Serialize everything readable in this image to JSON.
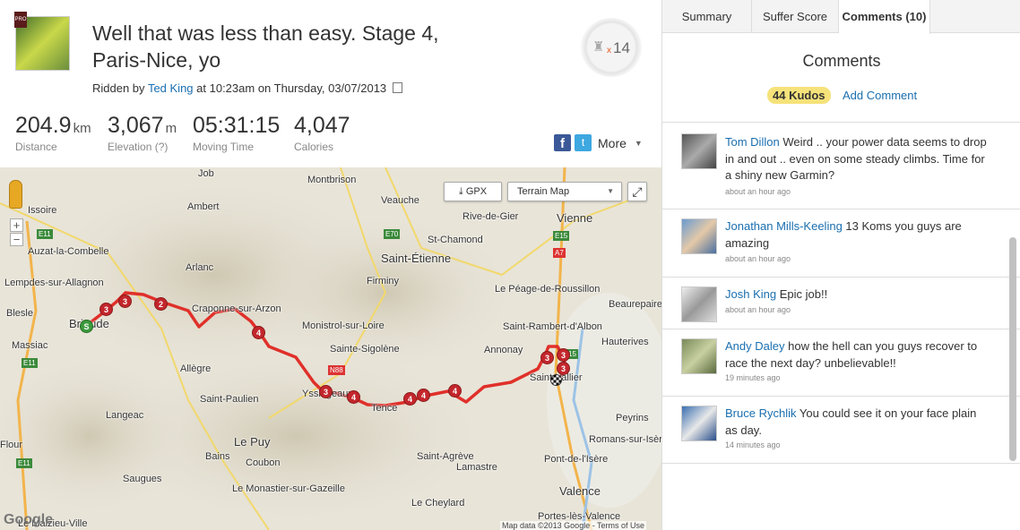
{
  "activity": {
    "title": "Well that was less than easy. Stage 4, Paris-Nice, yo",
    "ridden_prefix": "Ridden by",
    "rider": "Ted King",
    "ridden_suffix": "at 10:23am on Thursday, 03/07/2013",
    "achievements": "14",
    "achievements_x": "x"
  },
  "stats": [
    {
      "value": "204.9",
      "unit": "km",
      "label": "Distance"
    },
    {
      "value": "3,067",
      "unit": "m",
      "label": "Elevation (?)"
    },
    {
      "value": "05:31:15",
      "unit": "",
      "label": "Moving Time"
    },
    {
      "value": "4,047",
      "unit": "",
      "label": "Calories"
    }
  ],
  "share": {
    "more": "More"
  },
  "map": {
    "gpx": "GPX",
    "map_type": "Terrain Map",
    "google": "Google",
    "map_data": "Map data ©2013 Google - Terms of Use",
    "places": [
      "Issoire",
      "Job",
      "Montbrison",
      "Veauche",
      "Ambert",
      "Rive-de-Gier",
      "Vienne",
      "St-Chamond",
      "Auzat-la-Combelle",
      "Saint-Étienne",
      "Arlanc",
      "Firminy",
      "Lempdes-sur-Allagnon",
      "Le Péage-de-Roussillon",
      "Craponne-sur-Arzon",
      "Blesle",
      "Brioude",
      "Monistrol-sur-Loire",
      "Saint-Rambert-d'Albon",
      "Beaurepaire",
      "Massiac",
      "Sainte-Sigolène",
      "Annonay",
      "Hauterives",
      "Allègre",
      "Yssingeaux",
      "Saint-Vallier",
      "Saint-Paulien",
      "Tence",
      "Peyrins",
      "Langeac",
      "Le Puy",
      "Romans-sur-Isère",
      "Flour",
      "Bains",
      "Coubon",
      "Saint-Agrève",
      "Pont-de-l'Isère",
      "Lamastre",
      "Saugues",
      "Valence",
      "Le Monastier-sur-Gazeille",
      "Le Cheylard",
      "Le Malzieu-Ville",
      "Portes-lès-Valence"
    ],
    "roads": [
      "E11",
      "E70",
      "A7",
      "E15",
      "E11",
      "N88",
      "15",
      "E11"
    ],
    "markers": [
      "3",
      "3",
      "2",
      "4",
      "3",
      "4",
      "4",
      "4",
      "4",
      "3",
      "3",
      "3"
    ],
    "start_marker": "S"
  },
  "tabs": [
    "Summary",
    "Suffer Score",
    "Comments (10)"
  ],
  "comments_panel": {
    "title": "Comments",
    "kudos": "44 Kudos",
    "add_comment": "Add Comment"
  },
  "comments": [
    {
      "author": "Tom Dillon",
      "text": "Weird .. your power data seems to drop in and out .. even on some steady climbs. Time for a shiny new Garmin?",
      "time": "about an hour ago"
    },
    {
      "author": "Jonathan Mills-Keeling",
      "text": "13 Koms you guys are amazing",
      "time": "about an hour ago"
    },
    {
      "author": "Josh King",
      "text": "Epic job!!",
      "time": "about an hour ago"
    },
    {
      "author": "Andy Daley",
      "text": "how the hell can you guys recover to race the next day? unbelievable!!",
      "time": "19 minutes ago"
    },
    {
      "author": "Bruce Rychlik",
      "text": "You could see it on your face plain as day.",
      "time": "14 minutes ago"
    }
  ]
}
